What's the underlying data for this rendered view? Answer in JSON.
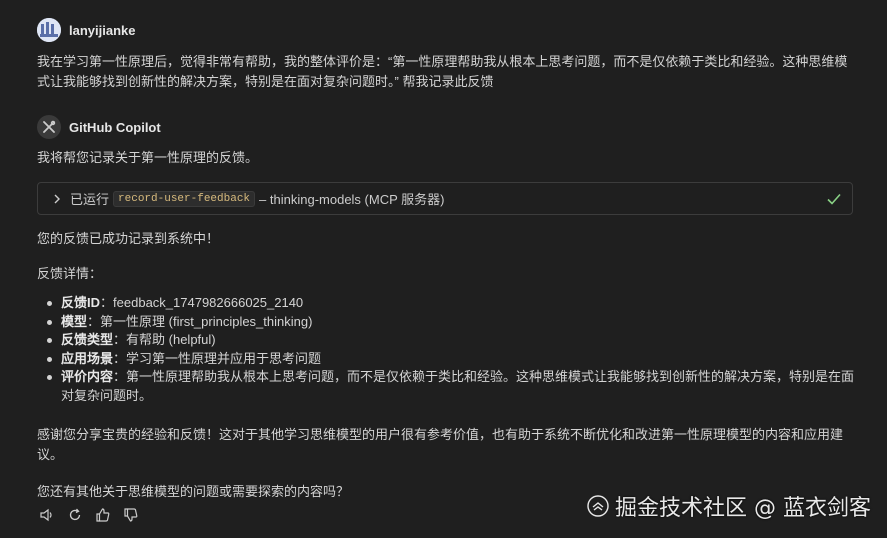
{
  "user": {
    "name": "lanyijianke",
    "message": "我在学习第一性原理后，觉得非常有帮助，我的整体评价是：“第一性原理帮助我从根本上思考问题，而不是仅依赖于类比和经验。这种思维模式让我能够找到创新性的解决方案，特别是在面对复杂问题时。” 帮我记录此反馈"
  },
  "assistant": {
    "name": "GitHub Copilot",
    "intro": "我将帮您记录关于第一性原理的反馈。",
    "tool": {
      "prefix": "已运行",
      "code": "record-user-feedback",
      "suffix": "– thinking-models (MCP 服务器)"
    },
    "success": "您的反馈已成功记录到系统中！",
    "details_title": "反馈详情：",
    "details": [
      {
        "key": "反馈ID",
        "sep": "：",
        "value": "feedback_1747982666025_2140"
      },
      {
        "key": "模型",
        "sep": "：",
        "value": "第一性原理 (first_principles_thinking)"
      },
      {
        "key": "反馈类型",
        "sep": "：",
        "value": "有帮助 (helpful)"
      },
      {
        "key": "应用场景",
        "sep": "：",
        "value": "学习第一性原理并应用于思考问题"
      },
      {
        "key": "评价内容",
        "sep": "：",
        "value": "第一性原理帮助我从根本上思考问题，而不是仅依赖于类比和经验。这种思维模式让我能够找到创新性的解决方案，特别是在面对复杂问题时。"
      }
    ],
    "thanks": "感谢您分享宝贵的经验和反馈！这对于其他学习思维模型的用户很有参考价值，也有助于系统不断优化和改进第一性原理模型的内容和应用建议。",
    "question": "您还有其他关于思维模型的问题或需要探索的内容吗？"
  },
  "actions": [
    "speaker-icon",
    "retry-icon",
    "thumbs-up-icon",
    "thumbs-down-icon"
  ],
  "watermark": "掘金技术社区 @ 蓝衣剑客",
  "colors": {
    "background": "#1f1f1f",
    "text": "#d4d4d4",
    "success_check": "#89d185"
  }
}
